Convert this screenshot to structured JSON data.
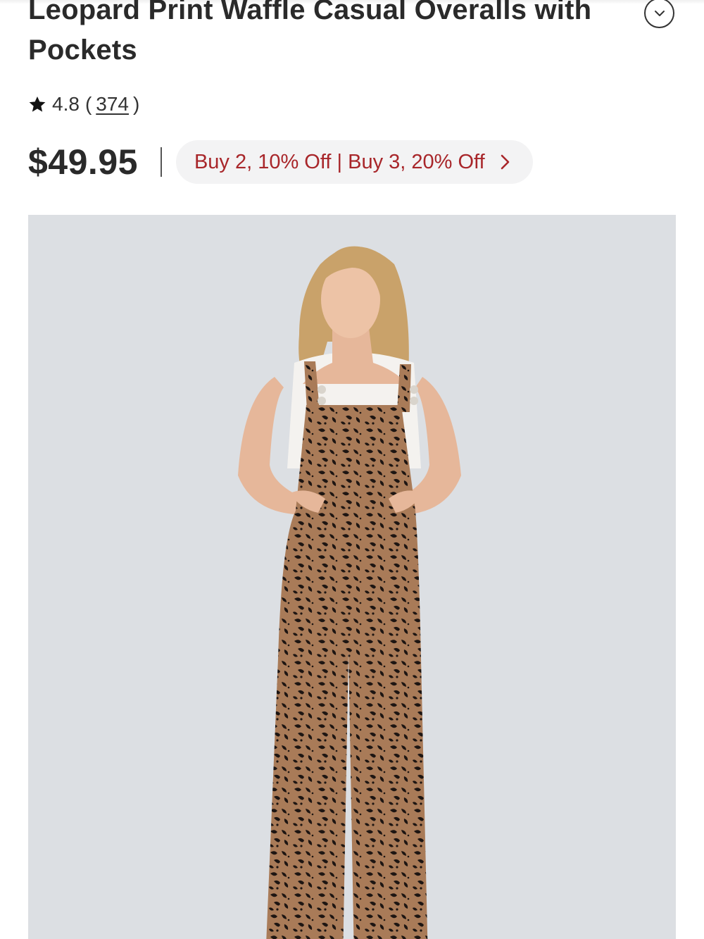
{
  "product": {
    "title": "Leopard Print Waffle Casual Overalls with Pockets",
    "rating": "4.8",
    "review_count": "374",
    "price": "$49.95",
    "promo_text": "Buy 2, 10% Off | Buy 3, 20% Off"
  },
  "icons": {
    "collapse": "chevron-down-icon",
    "star": "star-icon",
    "promo_arrow": "chevron-right-icon"
  },
  "colors": {
    "promo_text": "#a8262a",
    "promo_background": "#f3f3f4",
    "image_background": "#dcdfe3",
    "title": "#2a2a2a"
  }
}
